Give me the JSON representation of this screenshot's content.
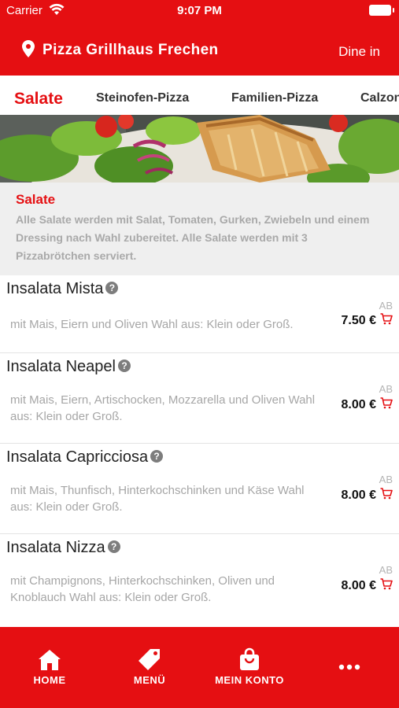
{
  "status_bar": {
    "carrier": "Carrier",
    "time": "9:07 PM"
  },
  "header": {
    "restaurant": "Pizza Grillhaus Frechen",
    "mode": "Dine in"
  },
  "tabs": [
    {
      "label": "Salate",
      "active": true
    },
    {
      "label": "Steinofen-Pizza",
      "active": false
    },
    {
      "label": "Familien-Pizza",
      "active": false
    },
    {
      "label": "Calzone",
      "active": false
    }
  ],
  "category": {
    "title": "Salate",
    "description": "Alle Salate werden mit Salat, Tomaten, Gurken, Zwiebeln und einem Dressing nach Wahl zubereitet. Alle Salate werden mit 3 Pizzabrötchen serviert."
  },
  "items": [
    {
      "name": "Insalata Mista",
      "description": "mit Mais, Eiern und Oliven Wahl aus: Klein oder Groß.",
      "prefix": "AB",
      "price": "7.50 €"
    },
    {
      "name": "Insalata Neapel",
      "description": "mit Mais, Eiern, Artischocken, Mozzarella und Oliven Wahl aus: Klein oder Groß.",
      "prefix": "AB",
      "price": "8.00 €"
    },
    {
      "name": "Insalata Capricciosa",
      "description": "mit Mais, Thunfisch, Hinterkochschinken und Käse Wahl aus: Klein oder Groß.",
      "prefix": "AB",
      "price": "8.00 €"
    },
    {
      "name": "Insalata Nizza",
      "description": "mit Champignons, Hinterkochschinken, Oliven und Knoblauch Wahl aus: Klein oder Groß.",
      "prefix": "AB",
      "price": "8.00 €"
    }
  ],
  "bottom_nav": [
    {
      "label": "HOME",
      "icon": "home-icon"
    },
    {
      "label": "MENÜ",
      "icon": "tag-icon"
    },
    {
      "label": "MEIN KONTO",
      "icon": "shopping-bag-icon"
    },
    {
      "label": "",
      "icon": "more-icon"
    }
  ],
  "colors": {
    "brand": "#e50f12",
    "category_bg": "#efefef",
    "muted_text": "#a6a6a6"
  }
}
